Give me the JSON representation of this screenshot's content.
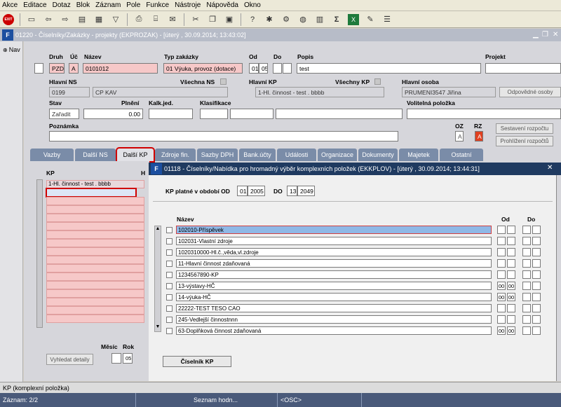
{
  "menu": [
    "Akce",
    "Editace",
    "Dotaz",
    "Blok",
    "Záznam",
    "Pole",
    "Funkce",
    "Nástroje",
    "Nápověda",
    "Okno"
  ],
  "toolbar_icons": [
    "exit-icon",
    "save-icon",
    "back-icon",
    "forward-icon",
    "enter-query-icon",
    "execute-query-icon",
    "filter-icon",
    "print-icon",
    "print-preview-icon",
    "mail-icon",
    "cut-icon",
    "copy-icon",
    "paste-icon",
    "help-icon",
    "settings-icon",
    "tools-icon",
    "browser-icon",
    "calculator-icon",
    "sum-icon",
    "excel-icon",
    "edit-icon",
    "list-icon"
  ],
  "exit_label": "EXIT",
  "app_icon": "F",
  "window1": {
    "title": "01220 - Číselníky/Zakázky - projekty (EKPROZAK) - [úterý , 30.09.2014; 13:43:02]",
    "nav_label": "Nav"
  },
  "form": {
    "druh_label": "Druh",
    "uc_label": "Úč",
    "nazev_label": "Název",
    "typ_label": "Typ zakázky",
    "od_label": "Od",
    "do_label": "Do",
    "popis_label": "Popis",
    "projekt_label": "Projekt",
    "druh_value": "PZD",
    "uc_value": "A",
    "nazev_value": "0101012",
    "typ_value": "01 Výuka, provoz (dotace)",
    "od_value": "01",
    "od_value2": "05",
    "popis_value": "test",
    "hlavni_ns_label": "Hlavní NS",
    "hlavni_ns_value": "0199",
    "hlavni_ns_name": "CP KAV",
    "vsechna_ns_label": "Všechna NS",
    "hlavni_kp_label": "Hlavní KP",
    "hlavni_kp_value": "1-Hl. činnost - test . bbbb",
    "vsechny_kp_label": "Všechny KP",
    "hlavni_osoba_label": "Hlavní osoba",
    "hlavni_osoba_value": "PRUMENI3547 Jiřina",
    "odpovedne_osoby_label": "Odpovědné osoby",
    "stav_label": "Stav",
    "stav_value": "Zařadit",
    "plneni_label": "Plnění",
    "plneni_value": "0.00",
    "kalk_label": "Kalk.jed.",
    "klasifikace_label": "Klasifikace",
    "volitelna_label": "Volitelná položka",
    "poznamka_label": "Poznámka",
    "oz_label": "OZ",
    "rz_label": "RZ",
    "oz_value": "A",
    "rz_value": "A",
    "sestaveni_label": "Sestavení rozpočtu",
    "prohlizeni_label": "Prohlížení rozpočtů"
  },
  "tabs": [
    "Vazby",
    "Další NS",
    "Další KP",
    "Zdroje fin.",
    "Sazby DPH",
    "Bank.účty",
    "Události",
    "Organizace",
    "Dokumenty",
    "Majetek",
    "Ostatní"
  ],
  "kp_panel": {
    "kp_header": "KP",
    "h_header": "H",
    "first_row": "1-Hl. činnost - test . bbbb",
    "mesic_label": "Měsíc",
    "rok_label": "Rok",
    "rok_value": "05",
    "vyhledat_label": "Vyhledat detaily"
  },
  "window2": {
    "title": "01118 - Číselníky/Nabídka pro hromadný výběr komplexních položek (EKKPLOV) - [úterý , 30.09.2014; 13:44:31]",
    "period_label": "KP platné v období OD",
    "period_od_month": "01",
    "period_od_year": "2005",
    "period_do_label": "DO",
    "period_do_month": "13",
    "period_do_year": "2049",
    "nazev_header": "Název",
    "od_header": "Od",
    "do_header": "Do",
    "rows": [
      {
        "name": "102010-Příspěvek",
        "od1": "",
        "od2": ""
      },
      {
        "name": "102031-Vlastní zdroje",
        "od1": "",
        "od2": ""
      },
      {
        "name": "1020310000-Hl.č.,věda,vl.zdroje",
        "od1": "",
        "od2": ""
      },
      {
        "name": "11-Hlavní činnost zdaňovaná",
        "od1": "",
        "od2": ""
      },
      {
        "name": "1234567890-KP",
        "od1": "",
        "od2": ""
      },
      {
        "name": "13-výstavy-HČ",
        "od1": "00",
        "od2": "00"
      },
      {
        "name": "14-výuka-HČ",
        "od1": "00",
        "od2": "00"
      },
      {
        "name": "22222-TEST TESO CAO",
        "od1": "",
        "od2": ""
      },
      {
        "name": "245-Vedlejší činnostnnn",
        "od1": "",
        "od2": ""
      },
      {
        "name": "63-Doplňková činnost zdaňovaná",
        "od1": "00",
        "od2": "00"
      }
    ],
    "ciselnik_button": "Číselník KP"
  },
  "status": {
    "hint": "KP (komplexní položka)",
    "record": "Záznam: 2/2",
    "mode": "Seznam hodn...",
    "osc": "<OSC>"
  },
  "colors": {
    "title_active": "#1f3a60",
    "title_inactive": "#b7bcc8",
    "tab": "#7a8ca8",
    "required": "#f6c8c8",
    "highlight": "#d00000"
  }
}
